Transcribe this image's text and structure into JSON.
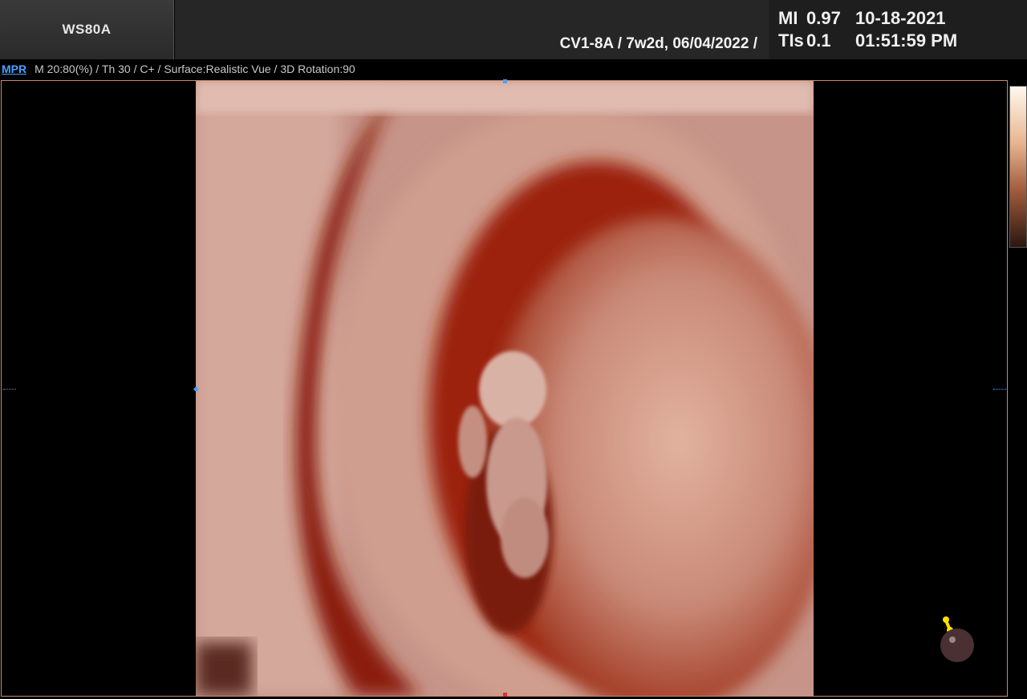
{
  "header": {
    "system_name": "WS80A",
    "probe_info": "CV1-8A / 7w2d, 06/04/2022 /",
    "mi_label": "MI",
    "mi_value": "0.97",
    "tis_label": "TIs",
    "tis_value": "0.1",
    "date": "10-18-2021",
    "time": "01:51:59 PM"
  },
  "status": {
    "mode_link": "MPR",
    "parameters": "M 20:80(%) / Th 30 / C+ / Surface:Realistic Vue / 3D Rotation:90"
  },
  "colors": {
    "mode_link": "#4aa0ff",
    "frame_border": "#c88a6c",
    "orientation_marker": "#ffe000"
  },
  "icons": {
    "orientation": "orientation-ball-icon"
  }
}
